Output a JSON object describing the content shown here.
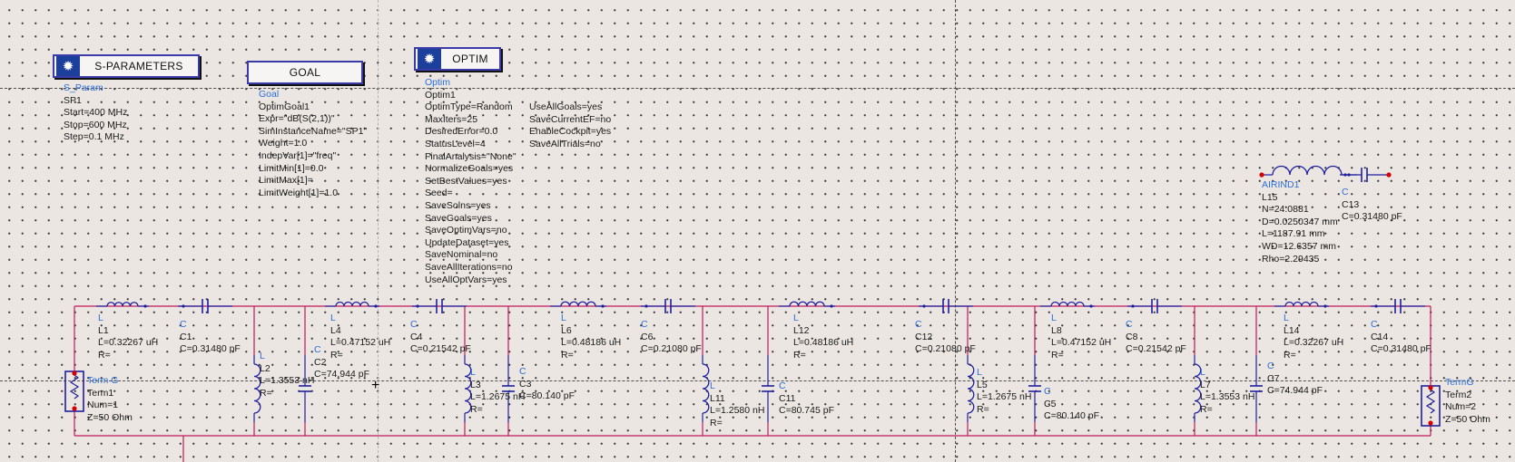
{
  "blocks": {
    "sparam": {
      "title": "S-PARAMETERS",
      "icon": "sparam-gear-icon"
    },
    "goal": {
      "title": "GOAL"
    },
    "optim": {
      "title": "OPTIM",
      "icon": "optim-gear-icon"
    }
  },
  "sparam_label": {
    "type": "S_Param",
    "lines": [
      "SP1",
      "Start=400 MHz",
      "Stop=600 MHz",
      "Step=0.1 MHz"
    ]
  },
  "goal_label": {
    "type": "Goal",
    "lines": [
      "OptimGoal1",
      "Expr=\"dB(S(2,1))\"",
      "SimInstanceName=\"SP1\"",
      "Weight=1.0",
      "IndepVar[1]=\"freq\"",
      "LimitMin[1]=0.0",
      "LimitMax[1]=",
      "LimitWeight[1]=1.0"
    ]
  },
  "optim_label": {
    "type": "Optim",
    "lines": [
      "Optim1",
      "OptimType=Random",
      "MaxIters=25",
      "DesiredError=0.0",
      "StatusLevel=4",
      "FinalAnalysis=\"None\"",
      "NormalizeGoals=yes",
      "SetBestValues=yes",
      "Seed=",
      "SaveSolns=yes",
      "SaveGoals=yes",
      "SaveOptimVars=no",
      "UpdateDataset=yes",
      "SaveNominal=no",
      "SaveAllIterations=no",
      "UseAllOptVars=yes"
    ]
  },
  "optim_label2": {
    "lines": [
      "UseAllGoals=yes",
      "SaveCurrentEF=no",
      "EnableCockpit=yes",
      "SaveAllTrials=no"
    ]
  },
  "airind": {
    "type": "AIRIND1",
    "lines": [
      "L15",
      "N=24.0881",
      "D=0.0250347 mm",
      "L=1187.91 mm",
      "WD=12.6357 mm",
      "Rho=2.29435"
    ]
  },
  "c13": {
    "type": "C",
    "lines": [
      "C13",
      "C=0.31480 pF"
    ]
  },
  "components": [
    {
      "id": "c-l1",
      "type": "L",
      "lines": [
        "L1",
        "L=0.32267 uH",
        "R="
      ]
    },
    {
      "id": "c-c1",
      "type": "C",
      "lines": [
        "C1",
        "C=0.31480 pF"
      ]
    },
    {
      "id": "c-l2",
      "type": "L",
      "lines": [
        "L2",
        "L=1.3553 nH",
        "R="
      ]
    },
    {
      "id": "c-c2",
      "type": "C",
      "lines": [
        "C2",
        "C=74.944 pF"
      ]
    },
    {
      "id": "c-l4",
      "type": "L",
      "lines": [
        "L4",
        "L=0.47152 uH",
        "R="
      ]
    },
    {
      "id": "c-c4",
      "type": "C",
      "lines": [
        "C4",
        "C=0.21542 pF"
      ]
    },
    {
      "id": "c-l3",
      "type": "L",
      "lines": [
        "L3",
        "L=1.2675 nH",
        "R="
      ]
    },
    {
      "id": "c-c3",
      "type": "C",
      "lines": [
        "C3",
        "C=80.140 pF"
      ]
    },
    {
      "id": "c-l6",
      "type": "L",
      "lines": [
        "L6",
        "L=0.48186 uH",
        "R="
      ]
    },
    {
      "id": "c-c6",
      "type": "C",
      "lines": [
        "C6",
        "C=0.21080 pF"
      ]
    },
    {
      "id": "c-l11",
      "type": "L",
      "lines": [
        "L11",
        "L=1.2580 nH",
        "R="
      ]
    },
    {
      "id": "c-c11",
      "type": "C",
      "lines": [
        "C11",
        "C=80.745 pF"
      ]
    },
    {
      "id": "c-l12",
      "type": "L",
      "lines": [
        "L12",
        "L=0.48186 uH",
        "R="
      ]
    },
    {
      "id": "c-c12",
      "type": "C",
      "lines": [
        "C12",
        "C=0.21080 pF"
      ]
    },
    {
      "id": "c-l5",
      "type": "L",
      "lines": [
        "L5",
        "L=1.2675 nH",
        "R="
      ]
    },
    {
      "id": "c-c5",
      "type": "C",
      "lines": [
        "C5",
        "C=80.140 pF"
      ]
    },
    {
      "id": "c-l8",
      "type": "L",
      "lines": [
        "L8",
        "L=0.47152 uH",
        "R="
      ]
    },
    {
      "id": "c-c8",
      "type": "C",
      "lines": [
        "C8",
        "C=0.21542 pF"
      ]
    },
    {
      "id": "c-l7",
      "type": "L",
      "lines": [
        "L7",
        "L=1.3553 nH",
        "R="
      ]
    },
    {
      "id": "c-c7",
      "type": "C",
      "lines": [
        "C7",
        "C=74.944 pF"
      ]
    },
    {
      "id": "c-l14",
      "type": "L",
      "lines": [
        "L14",
        "L=0.32267 uH",
        "R="
      ]
    },
    {
      "id": "c-c14",
      "type": "C",
      "lines": [
        "C14",
        "C=0.31480 pF"
      ]
    },
    {
      "id": "c-term1",
      "type": "Term G",
      "lines": [
        "Term1",
        "Num=1",
        "Z=50 Ohm"
      ]
    },
    {
      "id": "c-term2",
      "type": "TermG",
      "lines": [
        "Term2",
        "Num=2",
        "Z=50 Ohm"
      ]
    }
  ],
  "colors": {
    "wire": "#c2185b",
    "component": "#1f1f9f",
    "port": "#d40000",
    "typeLabel": "#2c6fd9",
    "canvas": "#ebe6e2"
  }
}
